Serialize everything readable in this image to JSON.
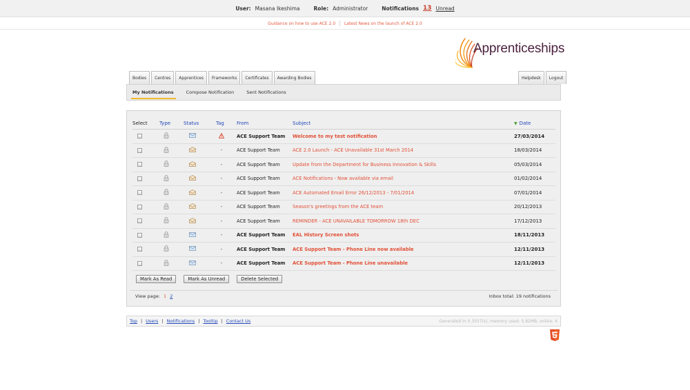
{
  "topbar": {
    "user_label": "User:",
    "user_name": "Masana Ikeshima",
    "role_label": "Role:",
    "role_value": "Administrator",
    "notifications_label": "Notifications",
    "unread_count": "13",
    "unread_label": "Unread"
  },
  "links": {
    "guidance": "Guidance on how to use ACE 2.0",
    "latest_news": "Latest News on the launch of ACE 2.0"
  },
  "logo": {
    "text": "Apprenticeships"
  },
  "tabs": [
    "Bodies",
    "Centres",
    "Apprentices",
    "Frameworks",
    "Certificates",
    "Awarding Bodies"
  ],
  "tabs_right": [
    "Helpdesk",
    "Logout"
  ],
  "subnav": [
    "My Notifications",
    "Compose Notification",
    "Sent Notifications"
  ],
  "table": {
    "headers": {
      "select": "Select",
      "type": "Type",
      "status": "Status",
      "tag": "Tag",
      "from": "From",
      "subject": "Subject",
      "date": "Date"
    },
    "rows": [
      {
        "from": "ACE Support Team",
        "subject": "Welcome to my test notification",
        "date": "27/03/2014",
        "tag": "!",
        "unread": true
      },
      {
        "from": "ACE Support Team",
        "subject": "ACE 2.0 Launch - ACE Unavailable 31st March 2014",
        "date": "18/03/2014",
        "tag": "-",
        "unread": false
      },
      {
        "from": "ACE Support Team",
        "subject": "Update from the Department for Business Innovation & Skills",
        "date": "05/03/2014",
        "tag": "-",
        "unread": false
      },
      {
        "from": "ACE Support Team",
        "subject": "ACE Notifications - Now available via email",
        "date": "01/02/2014",
        "tag": "-",
        "unread": false
      },
      {
        "from": "ACE Support Team",
        "subject": "ACE Automated Email Error 26/12/2013 - 7/01/2014",
        "date": "07/01/2014",
        "tag": "-",
        "unread": false
      },
      {
        "from": "ACE Support Team",
        "subject": "Season's greetings from the ACE team",
        "date": "20/12/2013",
        "tag": "-",
        "unread": false
      },
      {
        "from": "ACE Support Team",
        "subject": "REMINDER - ACE UNAVAILABLE TOMORROW 18th DEC",
        "date": "17/12/2013",
        "tag": "-",
        "unread": false
      },
      {
        "from": "ACE Support Team",
        "subject": "EAL History Screen shots",
        "date": "18/11/2013",
        "tag": "-",
        "unread": true
      },
      {
        "from": "ACE Support Team",
        "subject": "ACE Support Team - Phone Line now available",
        "date": "12/11/2013",
        "tag": "-",
        "unread": true
      },
      {
        "from": "ACE Support Team",
        "subject": "ACE Support Team - Phone Line unavailable",
        "date": "12/11/2013",
        "tag": "-",
        "unread": true
      }
    ]
  },
  "actions": {
    "mark_read": "Mark As Read",
    "mark_unread": "Mark As Unread",
    "delete": "Delete Selected"
  },
  "pager": {
    "label": "View page:",
    "pages": [
      "1",
      "2"
    ],
    "inbox_total": "Inbox total: 19 notifications"
  },
  "footer": {
    "links": [
      "Top",
      "Users",
      "Notifications",
      "Tooltip",
      "Contact Us"
    ],
    "stats": "Generated in 0.3557(s), memory used: 5.82MB, online: 4"
  },
  "colors": {
    "accent": "#e14f36",
    "link": "#2148b8",
    "logo": "#4a1f3c",
    "underline": "#f0b82a"
  }
}
